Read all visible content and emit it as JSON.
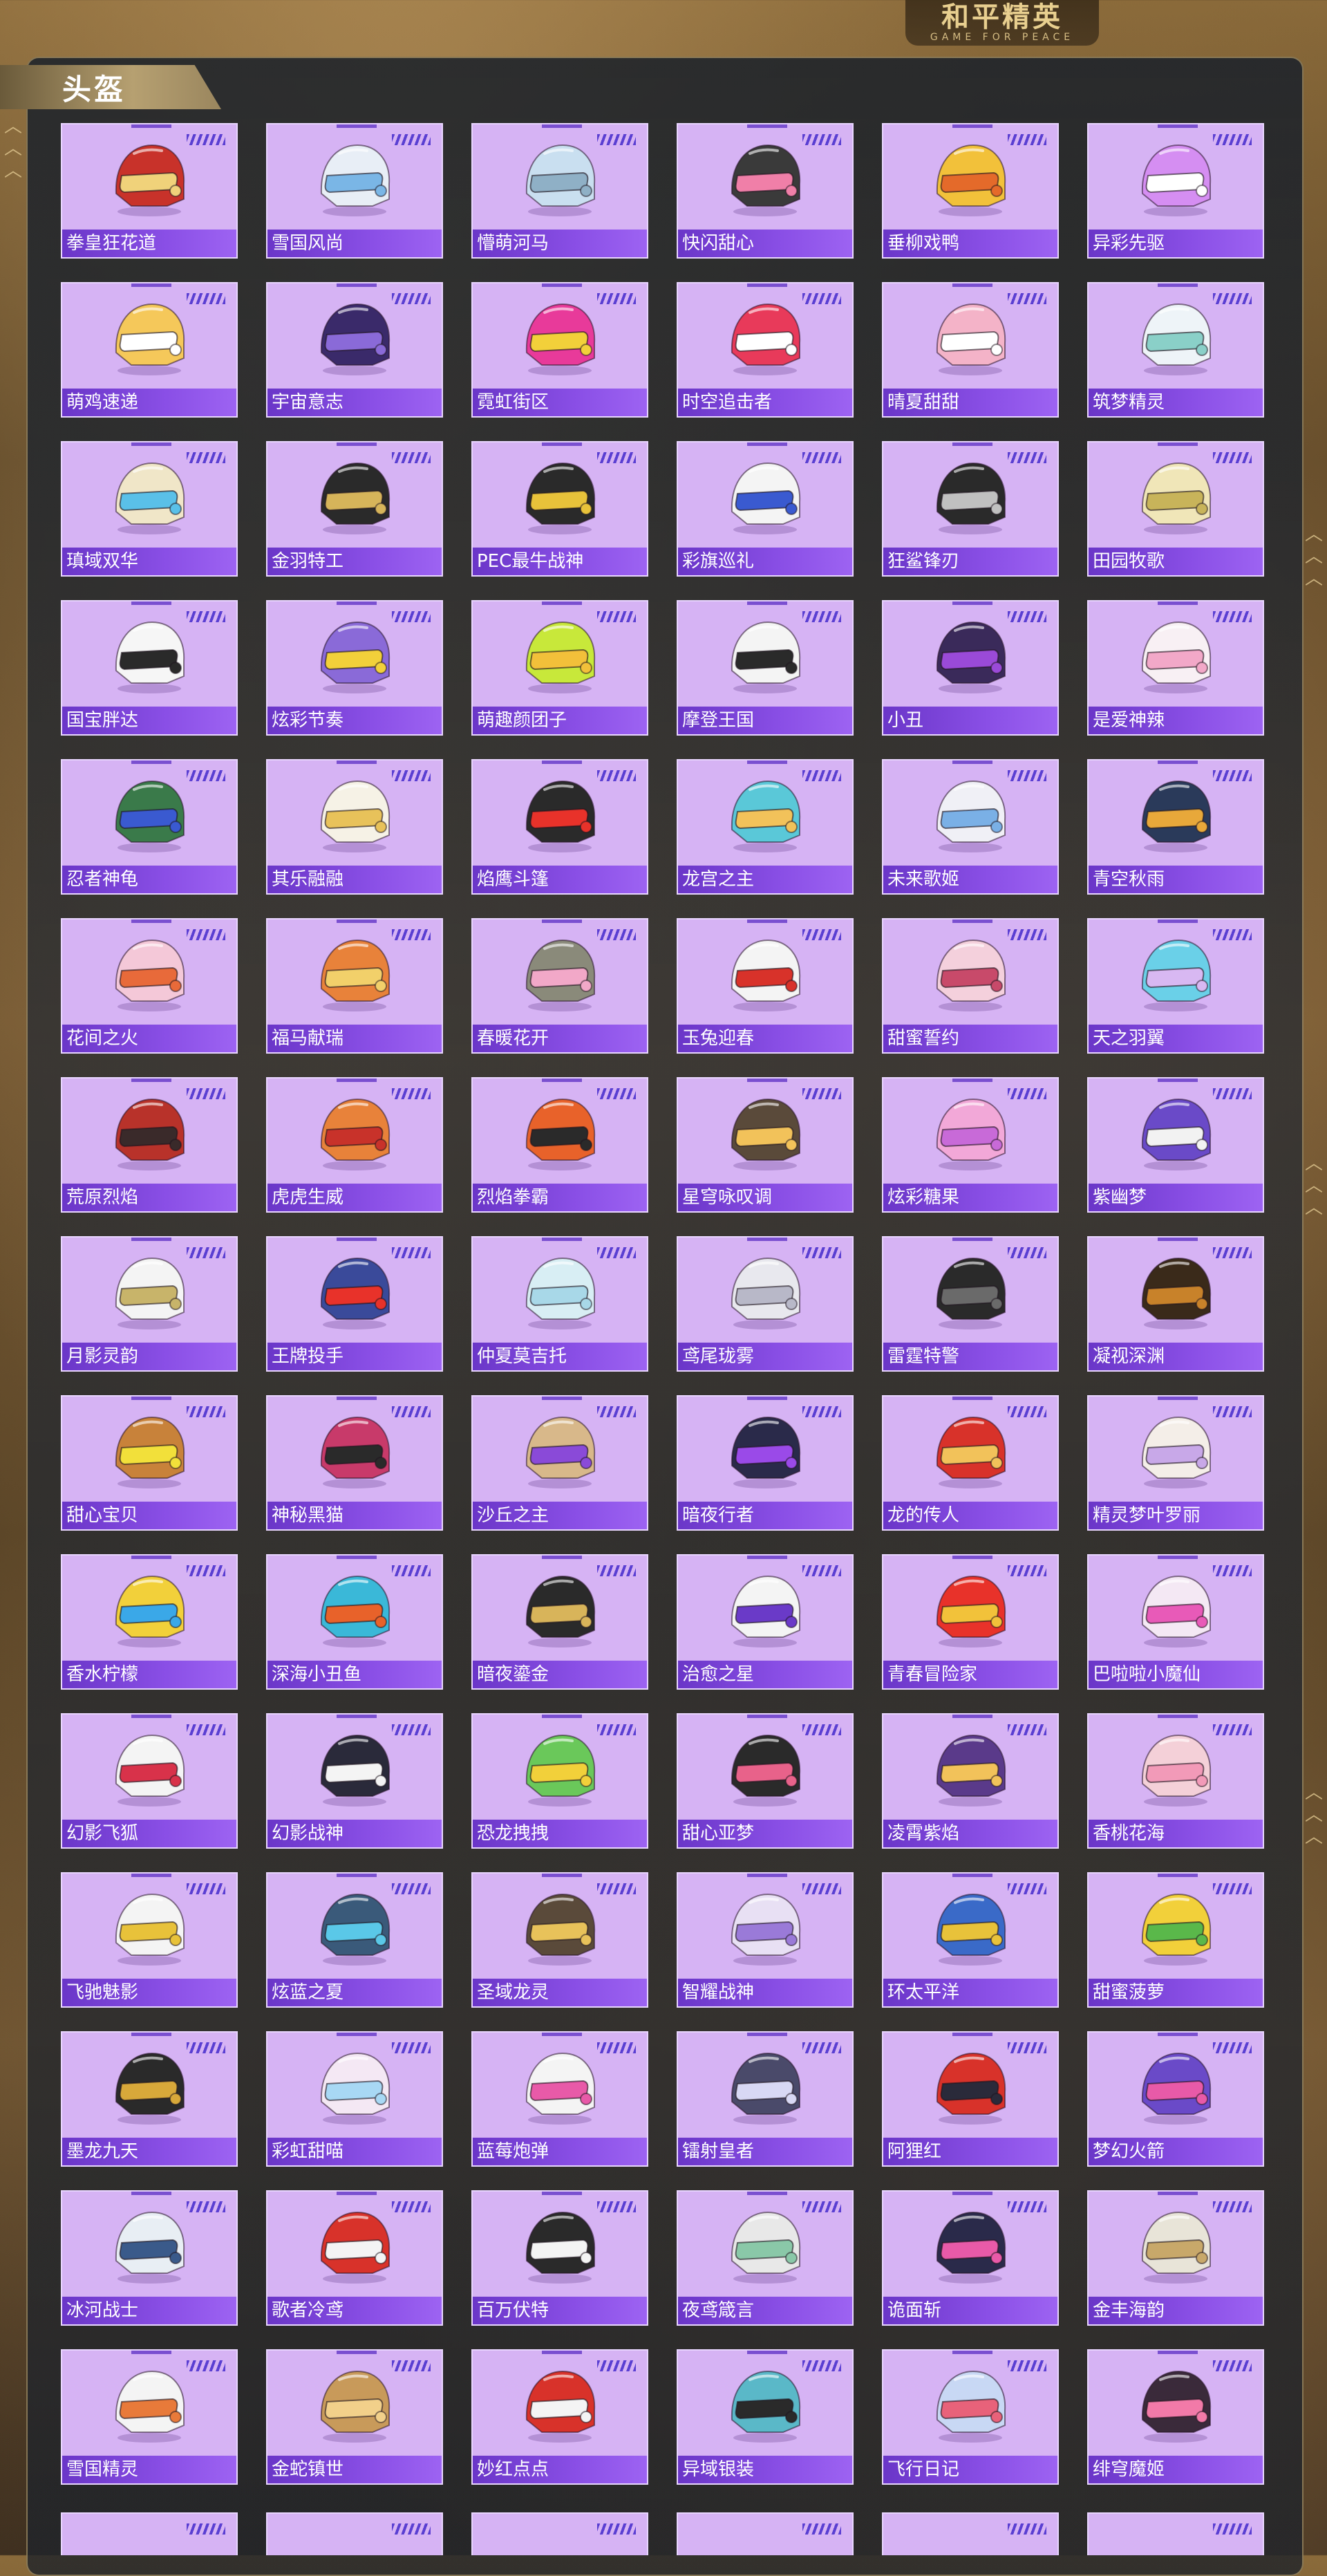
{
  "logo": {
    "cn": "和平精英",
    "en": "GAME FOR PEACE"
  },
  "section": {
    "title": "头盔"
  },
  "colors": {
    "card_bg": "#d6b3f4",
    "label_bg": "#7a44d8",
    "accent": "#5a3fd2",
    "frame_gold": "#c9ad6e"
  },
  "helmets": [
    {
      "name": "拳皇狂花道",
      "c1": "#c8322a",
      "c2": "#f0d27a"
    },
    {
      "name": "雪国风尚",
      "c1": "#e8eef6",
      "c2": "#7ab6e6"
    },
    {
      "name": "懵萌河马",
      "c1": "#c9dff0",
      "c2": "#8fb0c6"
    },
    {
      "name": "快闪甜心",
      "c1": "#3a3a3a",
      "c2": "#f07fa8"
    },
    {
      "name": "垂柳戏鸭",
      "c1": "#f2c13a",
      "c2": "#e46a2a"
    },
    {
      "name": "异彩先驱",
      "c1": "#d58ef2",
      "c2": "#ffffff"
    },
    {
      "name": "萌鸡速递",
      "c1": "#f5c85a",
      "c2": "#ffffff"
    },
    {
      "name": "宇宙意志",
      "c1": "#3a2a6a",
      "c2": "#8a6ad8"
    },
    {
      "name": "霓虹街区",
      "c1": "#e83a9a",
      "c2": "#f2d03a"
    },
    {
      "name": "时空追击者",
      "c1": "#e83a5a",
      "c2": "#ffffff"
    },
    {
      "name": "晴夏甜甜",
      "c1": "#f4b3c8",
      "c2": "#ffffff"
    },
    {
      "name": "筑梦精灵",
      "c1": "#eef4f8",
      "c2": "#8ad0c8"
    },
    {
      "name": "瑱域双华",
      "c1": "#f0e6c8",
      "c2": "#5ac0e8"
    },
    {
      "name": "金羽特工",
      "c1": "#2a2a2a",
      "c2": "#d6b45a"
    },
    {
      "name": "PEC最牛战神",
      "c1": "#2a2a2a",
      "c2": "#e8c23a"
    },
    {
      "name": "彩旗巡礼",
      "c1": "#f4f4f4",
      "c2": "#3a5ad0"
    },
    {
      "name": "狂鲨锋刃",
      "c1": "#2a2a2a",
      "c2": "#c0c0c0"
    },
    {
      "name": "田园牧歌",
      "c1": "#f0e6b8",
      "c2": "#c8b45a"
    },
    {
      "name": "国宝胖达",
      "c1": "#f6f6f6",
      "c2": "#2a2a2a"
    },
    {
      "name": "炫彩节奏",
      "c1": "#8a6ad8",
      "c2": "#f2d03a"
    },
    {
      "name": "萌趣颜团子",
      "c1": "#c8e83a",
      "c2": "#f2c03a"
    },
    {
      "name": "摩登王国",
      "c1": "#f4f4f4",
      "c2": "#2a2a2a"
    },
    {
      "name": "小丑",
      "c1": "#3a2a5a",
      "c2": "#9a4ad8"
    },
    {
      "name": "是爱神辣",
      "c1": "#f8f0f4",
      "c2": "#f2a8c8"
    },
    {
      "name": "忍者神龟",
      "c1": "#3a7a4a",
      "c2": "#3a5ad0"
    },
    {
      "name": "其乐融融",
      "c1": "#f6f2e6",
      "c2": "#e8c25a"
    },
    {
      "name": "焰鹰斗篷",
      "c1": "#2a2a2a",
      "c2": "#e8322a"
    },
    {
      "name": "龙宫之主",
      "c1": "#5ac8d8",
      "c2": "#f2c25a"
    },
    {
      "name": "未来歌姬",
      "c1": "#f0f0f6",
      "c2": "#7ab0e6"
    },
    {
      "name": "青空秋雨",
      "c1": "#2a3a5a",
      "c2": "#e8a83a"
    },
    {
      "name": "花间之火",
      "c1": "#f4c8d8",
      "c2": "#e86a3a"
    },
    {
      "name": "福马献瑞",
      "c1": "#e8823a",
      "c2": "#f2d06a"
    },
    {
      "name": "春暖花开",
      "c1": "#8a8a7a",
      "c2": "#f2a8c8"
    },
    {
      "name": "玉兔迎春",
      "c1": "#f4f4f4",
      "c2": "#d8322a"
    },
    {
      "name": "甜蜜誓约",
      "c1": "#f4d0dc",
      "c2": "#c84a6a"
    },
    {
      "name": "天之羽翼",
      "c1": "#6ad0e8",
      "c2": "#d8b8f2"
    },
    {
      "name": "荒原烈焰",
      "c1": "#b8322a",
      "c2": "#3a2a2a"
    },
    {
      "name": "虎虎生威",
      "c1": "#e8823a",
      "c2": "#c8322a"
    },
    {
      "name": "烈焰拳霸",
      "c1": "#e8622a",
      "c2": "#2a2a2a"
    },
    {
      "name": "星穹咏叹调",
      "c1": "#5a4a3a",
      "c2": "#f2c25a"
    },
    {
      "name": "炫彩糖果",
      "c1": "#f2a8d8",
      "c2": "#c86ad8"
    },
    {
      "name": "紫幽梦",
      "c1": "#6a4ac8",
      "c2": "#f2f2f2"
    },
    {
      "name": "月影灵韵",
      "c1": "#f4f4f4",
      "c2": "#c8b46a"
    },
    {
      "name": "王牌投手",
      "c1": "#3a4a9a",
      "c2": "#e8322a"
    },
    {
      "name": "仲夏莫吉托",
      "c1": "#d8eef4",
      "c2": "#a8d8e8"
    },
    {
      "name": "鸢尾珑雾",
      "c1": "#e8e8ee",
      "c2": "#b8b8c8"
    },
    {
      "name": "雷霆特警",
      "c1": "#2a2a2a",
      "c2": "#6a6a6a"
    },
    {
      "name": "凝视深渊",
      "c1": "#3a2a1a",
      "c2": "#c8822a"
    },
    {
      "name": "甜心宝贝",
      "c1": "#c8823a",
      "c2": "#f2e03a"
    },
    {
      "name": "神秘黑猫",
      "c1": "#c83a6a",
      "c2": "#2a2a2a"
    },
    {
      "name": "沙丘之主",
      "c1": "#d8b88a",
      "c2": "#8a4ad8"
    },
    {
      "name": "暗夜行者",
      "c1": "#2a2a4a",
      "c2": "#9a4ae8"
    },
    {
      "name": "龙的传人",
      "c1": "#d8322a",
      "c2": "#f2c25a"
    },
    {
      "name": "精灵梦叶罗丽",
      "c1": "#f4eee8",
      "c2": "#c8a8e8"
    },
    {
      "name": "香水柠檬",
      "c1": "#f2d03a",
      "c2": "#3aa8e8"
    },
    {
      "name": "深海小丑鱼",
      "c1": "#3ab8d8",
      "c2": "#e8622a"
    },
    {
      "name": "暗夜鎏金",
      "c1": "#2a2a2a",
      "c2": "#d8b45a"
    },
    {
      "name": "治愈之星",
      "c1": "#f4f4f4",
      "c2": "#6a3ac8"
    },
    {
      "name": "青春冒险家",
      "c1": "#e8322a",
      "c2": "#f2c23a"
    },
    {
      "name": "巴啦啦小魔仙",
      "c1": "#f4e8f4",
      "c2": "#e85ab8"
    },
    {
      "name": "幻影飞狐",
      "c1": "#f4f4f4",
      "c2": "#d8324a"
    },
    {
      "name": "幻影战神",
      "c1": "#2a2a3a",
      "c2": "#f4f4f4"
    },
    {
      "name": "恐龙拽拽",
      "c1": "#6ac85a",
      "c2": "#f2d03a"
    },
    {
      "name": "甜心亚梦",
      "c1": "#2a2a2a",
      "c2": "#e8628a"
    },
    {
      "name": "凌霄紫焰",
      "c1": "#5a3a8a",
      "c2": "#f2c25a"
    },
    {
      "name": "香桃花海",
      "c1": "#f4d0d8",
      "c2": "#f29ab8"
    },
    {
      "name": "飞驰魅影",
      "c1": "#f4f4f4",
      "c2": "#e8c23a"
    },
    {
      "name": "炫蓝之夏",
      "c1": "#3a5a7a",
      "c2": "#5ac8e8"
    },
    {
      "name": "圣域龙灵",
      "c1": "#5a4a3a",
      "c2": "#e8c25a"
    },
    {
      "name": "智耀战神",
      "c1": "#e8e0f4",
      "c2": "#9a7ad8"
    },
    {
      "name": "环太平洋",
      "c1": "#3a6ac8",
      "c2": "#e8c23a"
    },
    {
      "name": "甜蜜菠萝",
      "c1": "#f2d03a",
      "c2": "#5ab84a"
    },
    {
      "name": "墨龙九天",
      "c1": "#2a2a2a",
      "c2": "#d8a83a"
    },
    {
      "name": "彩虹甜喵",
      "c1": "#f4e8f4",
      "c2": "#a8d8f4"
    },
    {
      "name": "蓝莓炮弹",
      "c1": "#f4f4f4",
      "c2": "#e85aa8"
    },
    {
      "name": "镭射皇者",
      "c1": "#4a4a6a",
      "c2": "#d8d8f4"
    },
    {
      "name": "阿狸红",
      "c1": "#d8322a",
      "c2": "#2a2a3a"
    },
    {
      "name": "梦幻火箭",
      "c1": "#6a4ac8",
      "c2": "#e85aa8"
    },
    {
      "name": "冰河战士",
      "c1": "#e8eef4",
      "c2": "#3a5a8a"
    },
    {
      "name": "歌者冷鸢",
      "c1": "#d8322a",
      "c2": "#f4f4f4"
    },
    {
      "name": "百万伏特",
      "c1": "#2a2a2a",
      "c2": "#f4f4f4"
    },
    {
      "name": "夜鸢箴言",
      "c1": "#e8e8e8",
      "c2": "#8ac8a8"
    },
    {
      "name": "诡面斩",
      "c1": "#2a2a4a",
      "c2": "#e85aa8"
    },
    {
      "name": "金丰海韵",
      "c1": "#e8e4d8",
      "c2": "#c8a86a"
    },
    {
      "name": "雪国精灵",
      "c1": "#f4f4f4",
      "c2": "#e87a3a"
    },
    {
      "name": "金蛇镇世",
      "c1": "#c89a5a",
      "c2": "#f2d08a"
    },
    {
      "name": "妙红点点",
      "c1": "#d8322a",
      "c2": "#f4f4f4"
    },
    {
      "name": "异域银装",
      "c1": "#5ab8c8",
      "c2": "#2a2a2a"
    },
    {
      "name": "飞行日记",
      "c1": "#c8d8f4",
      "c2": "#e8627a"
    },
    {
      "name": "绯穹魔姬",
      "c1": "#3a2a3a",
      "c2": "#f27aa8"
    }
  ]
}
